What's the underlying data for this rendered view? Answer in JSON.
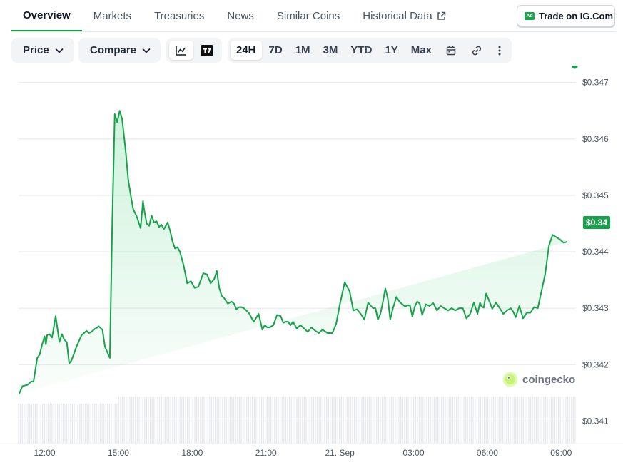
{
  "tabs": [
    {
      "label": "Overview",
      "active": true
    },
    {
      "label": "Markets"
    },
    {
      "label": "Treasuries"
    },
    {
      "label": "News"
    },
    {
      "label": "Similar Coins"
    },
    {
      "label": "Historical Data",
      "icon": "external-link-icon"
    }
  ],
  "ad": {
    "badge": "Ad",
    "label": "Trade on IG.Com"
  },
  "toolbar": {
    "price_label": "Price",
    "compare_label": "Compare",
    "chart_types": [
      {
        "icon": "line-chart-icon",
        "active": true
      },
      {
        "icon": "tradingview-icon"
      }
    ],
    "ranges": [
      "24H",
      "7D",
      "1M",
      "3M",
      "YTD",
      "1Y",
      "Max"
    ],
    "active_range": "24H",
    "tools": [
      "calendar-icon",
      "link-icon",
      "more-vertical-icon"
    ]
  },
  "watermark": "coingecko",
  "colors": {
    "line": "#16a34a",
    "fill": "#dcfce7",
    "accent": "#16a34a"
  },
  "current_price_label": "$0.34",
  "chart_data": {
    "type": "area",
    "y_ticks": [
      "$0.347",
      "$0.346",
      "$0.345",
      "$0.344",
      "$0.343",
      "$0.342",
      "$0.341"
    ],
    "y_tick_values": [
      0.347,
      0.346,
      0.345,
      0.344,
      0.343,
      0.342,
      0.341
    ],
    "ylim": [
      0.3406,
      0.3473
    ],
    "xlim": [
      10.94,
      33.6
    ],
    "x_ticks": [
      {
        "label": "12:00",
        "x": 12
      },
      {
        "label": "15:00",
        "x": 15
      },
      {
        "label": "18:00",
        "x": 18
      },
      {
        "label": "21:00",
        "x": 21
      },
      {
        "label": "21. Sep",
        "x": 24
      },
      {
        "label": "03:00",
        "x": 27
      },
      {
        "label": "06:00",
        "x": 30
      },
      {
        "label": "09:00",
        "x": 33
      }
    ],
    "grid": true,
    "x": [
      10.96,
      11.1,
      11.3,
      11.45,
      11.55,
      11.7,
      11.8,
      11.9,
      12.0,
      12.05,
      12.1,
      12.2,
      12.3,
      12.35,
      12.45,
      12.5,
      12.6,
      12.7,
      12.8,
      12.9,
      13.0,
      13.1,
      13.3,
      13.5,
      13.6,
      13.7,
      13.8,
      13.9,
      14.0,
      14.2,
      14.35,
      14.45,
      14.55,
      14.65,
      14.75,
      14.85,
      14.95,
      15.05,
      15.15,
      15.3,
      15.4,
      15.5,
      15.6,
      15.75,
      15.9,
      16.0,
      16.05,
      16.15,
      16.25,
      16.35,
      16.45,
      16.55,
      16.65,
      16.75,
      16.85,
      17.0,
      17.1,
      17.2,
      17.3,
      17.4,
      17.5,
      17.65,
      17.8,
      17.95,
      18.1,
      18.25,
      18.35,
      18.45,
      18.6,
      18.75,
      18.9,
      19.0,
      19.1,
      19.2,
      19.3,
      19.45,
      19.6,
      19.7,
      19.8,
      19.9,
      20.0,
      20.1,
      20.3,
      20.5,
      20.7,
      20.85,
      20.95,
      21.05,
      21.15,
      21.3,
      21.45,
      21.6,
      21.7,
      21.8,
      21.9,
      22.0,
      22.1,
      22.25,
      22.4,
      22.55,
      22.7,
      22.85,
      23.0,
      23.15,
      23.3,
      23.5,
      23.7,
      23.85,
      24.0,
      24.2,
      24.4,
      24.55,
      24.7,
      24.85,
      25.0,
      25.15,
      25.35,
      25.45,
      25.55,
      25.65,
      25.75,
      25.85,
      25.95,
      26.05,
      26.15,
      26.3,
      26.45,
      26.55,
      26.65,
      26.75,
      26.85,
      26.95,
      27.05,
      27.15,
      27.25,
      27.35,
      27.5,
      27.65,
      27.8,
      27.95,
      28.1,
      28.25,
      28.4,
      28.55,
      28.7,
      28.85,
      29.0,
      29.15,
      29.3,
      29.45,
      29.6,
      29.7,
      29.75,
      29.85,
      29.95,
      30.05,
      30.2,
      30.35,
      30.5,
      30.65,
      30.8,
      30.95,
      31.05,
      31.15,
      31.3,
      31.45,
      31.6,
      31.75,
      31.9,
      32.05,
      32.2,
      32.35,
      32.5,
      32.65,
      32.8,
      32.95,
      33.1,
      33.25,
      33.4,
      33.55
    ],
    "y": [
      0.34148,
      0.34162,
      0.34164,
      0.3417,
      0.3417,
      0.34212,
      0.34218,
      0.34236,
      0.3425,
      0.34236,
      0.34252,
      0.34254,
      0.34248,
      0.3426,
      0.34286,
      0.3427,
      0.3424,
      0.34254,
      0.34244,
      0.3424,
      0.34202,
      0.34208,
      0.34232,
      0.34252,
      0.34256,
      0.3426,
      0.34256,
      0.34258,
      0.34262,
      0.34268,
      0.34262,
      0.34232,
      0.34222,
      0.34212,
      0.34452,
      0.34644,
      0.3463,
      0.3465,
      0.34636,
      0.34576,
      0.34528,
      0.345,
      0.34476,
      0.34462,
      0.34442,
      0.3449,
      0.34474,
      0.3445,
      0.34446,
      0.34464,
      0.34452,
      0.34454,
      0.34444,
      0.34448,
      0.3444,
      0.34452,
      0.34438,
      0.34418,
      0.34406,
      0.34408,
      0.344,
      0.34376,
      0.34344,
      0.34348,
      0.34336,
      0.34338,
      0.3435,
      0.34362,
      0.3436,
      0.34344,
      0.34352,
      0.34366,
      0.34336,
      0.34322,
      0.34318,
      0.34308,
      0.34312,
      0.34308,
      0.34298,
      0.34302,
      0.34302,
      0.343,
      0.34292,
      0.34276,
      0.3429,
      0.34262,
      0.3427,
      0.34266,
      0.34266,
      0.3427,
      0.34288,
      0.34286,
      0.34274,
      0.34276,
      0.34276,
      0.3427,
      0.34276,
      0.34264,
      0.3427,
      0.34264,
      0.34258,
      0.34266,
      0.3426,
      0.34256,
      0.34262,
      0.34256,
      0.34256,
      0.34272,
      0.34306,
      0.34346,
      0.3433,
      0.34296,
      0.34298,
      0.3429,
      0.3428,
      0.3431,
      0.343,
      0.343,
      0.3428,
      0.3429,
      0.3431,
      0.34335,
      0.34318,
      0.3428,
      0.34298,
      0.3432,
      0.3431,
      0.34307,
      0.34303,
      0.34305,
      0.34305,
      0.34285,
      0.34303,
      0.34312,
      0.34308,
      0.34288,
      0.34307,
      0.34304,
      0.34309,
      0.34296,
      0.34304,
      0.343,
      0.34296,
      0.343,
      0.34296,
      0.343,
      0.343,
      0.34282,
      0.3429,
      0.3431,
      0.3429,
      0.3431,
      0.34304,
      0.34301,
      0.34326,
      0.34316,
      0.34299,
      0.3431,
      0.343,
      0.3429,
      0.34296,
      0.343,
      0.34294,
      0.34284,
      0.34304,
      0.34282,
      0.34292,
      0.34292,
      0.34302,
      0.343,
      0.3433,
      0.3436,
      0.3441,
      0.3443,
      0.34426,
      0.34422,
      0.34416,
      0.34418
    ]
  }
}
